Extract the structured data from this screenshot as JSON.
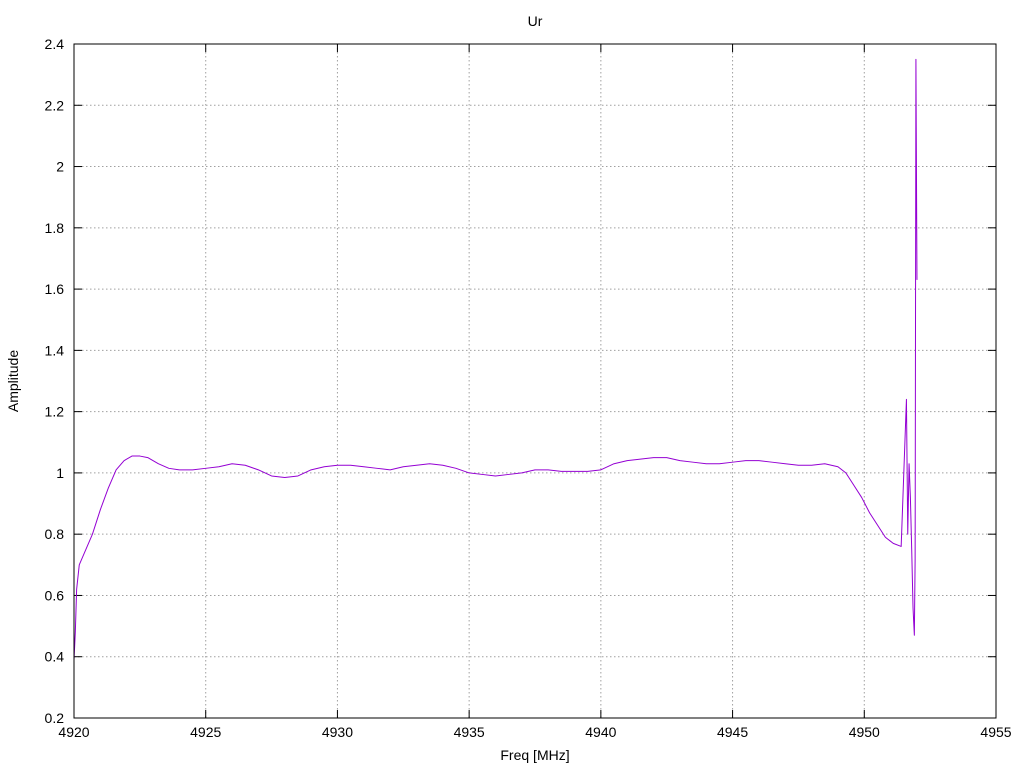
{
  "chart_data": {
    "type": "line",
    "title": "Ur",
    "xlabel": "Freq [MHz]",
    "ylabel": "Amplitude",
    "xlim": [
      4920,
      4955
    ],
    "ylim": [
      0.2,
      2.4
    ],
    "xticks": [
      4920,
      4925,
      4930,
      4935,
      4940,
      4945,
      4950,
      4955
    ],
    "yticks": [
      0.2,
      0.4,
      0.6,
      0.8,
      1,
      1.2,
      1.4,
      1.6,
      1.8,
      2,
      2.2,
      2.4
    ],
    "ytick_labels": [
      "0.2",
      "0.4",
      "0.6",
      "0.8",
      "1",
      "1.2",
      "1.4",
      "1.6",
      "1.8",
      "2",
      "2.2",
      "2.4"
    ],
    "grid": true,
    "legend": "none",
    "series": [
      {
        "color": "#9400d3",
        "x": [
          4920.0,
          4920.05,
          4920.1,
          4920.2,
          4920.3,
          4920.5,
          4920.7,
          4921.0,
          4921.3,
          4921.6,
          4921.9,
          4922.2,
          4922.5,
          4922.8,
          4923.2,
          4923.6,
          4924.0,
          4924.5,
          4925.0,
          4925.5,
          4926.0,
          4926.5,
          4927.0,
          4927.5,
          4928.0,
          4928.5,
          4929.0,
          4929.5,
          4930.0,
          4930.5,
          4931.0,
          4931.5,
          4932.0,
          4932.5,
          4933.0,
          4933.5,
          4934.0,
          4934.5,
          4935.0,
          4935.5,
          4936.0,
          4936.5,
          4937.0,
          4937.5,
          4938.0,
          4938.5,
          4939.0,
          4939.5,
          4940.0,
          4940.5,
          4941.0,
          4941.5,
          4942.0,
          4942.5,
          4943.0,
          4943.5,
          4944.0,
          4944.5,
          4945.0,
          4945.5,
          4946.0,
          4946.5,
          4947.0,
          4947.5,
          4948.0,
          4948.5,
          4949.0,
          4949.3,
          4949.6,
          4949.9,
          4950.2,
          4950.5,
          4950.8,
          4951.1,
          4951.4,
          4951.6,
          4951.65,
          4951.7,
          4951.75,
          4951.8,
          4951.85,
          4951.9,
          4951.93,
          4951.96,
          4952.0
        ],
        "y": [
          0.39,
          0.48,
          0.62,
          0.7,
          0.72,
          0.76,
          0.8,
          0.88,
          0.95,
          1.01,
          1.04,
          1.055,
          1.055,
          1.05,
          1.03,
          1.015,
          1.01,
          1.01,
          1.015,
          1.02,
          1.03,
          1.025,
          1.01,
          0.99,
          0.985,
          0.99,
          1.01,
          1.02,
          1.025,
          1.025,
          1.02,
          1.015,
          1.01,
          1.02,
          1.025,
          1.03,
          1.025,
          1.015,
          1.0,
          0.995,
          0.99,
          0.995,
          1.0,
          1.01,
          1.01,
          1.005,
          1.005,
          1.005,
          1.01,
          1.03,
          1.04,
          1.045,
          1.05,
          1.05,
          1.04,
          1.035,
          1.03,
          1.03,
          1.035,
          1.04,
          1.04,
          1.035,
          1.03,
          1.025,
          1.025,
          1.03,
          1.02,
          1.0,
          0.96,
          0.92,
          0.87,
          0.83,
          0.79,
          0.77,
          0.76,
          1.24,
          0.8,
          1.03,
          0.92,
          0.75,
          0.56,
          0.47,
          0.72,
          2.35,
          1.63
        ]
      }
    ]
  }
}
